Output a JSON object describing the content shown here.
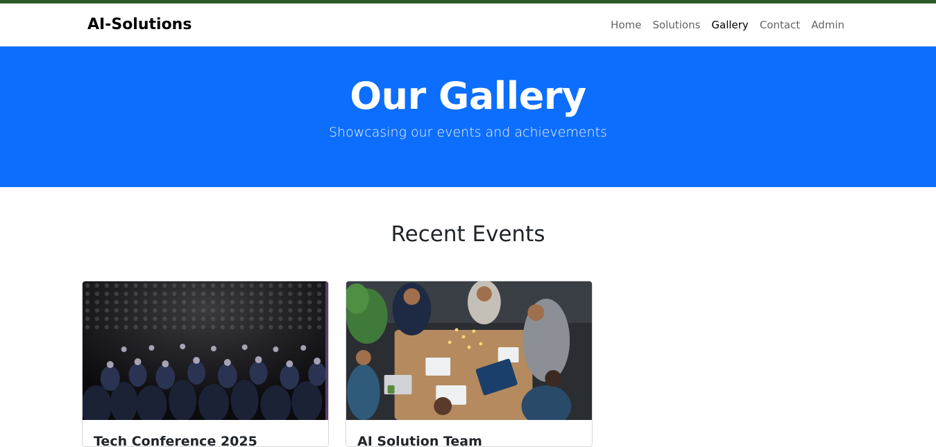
{
  "navbar": {
    "brand": "AI-Solutions",
    "links": [
      "Home",
      "Solutions",
      "Gallery",
      "Contact",
      "Admin"
    ],
    "active": "Gallery"
  },
  "hero": {
    "title": "Our Gallery",
    "subtitle": "Showcasing our events and achievements"
  },
  "section": {
    "title": "Recent Events"
  },
  "cards": [
    {
      "title": "Tech Conference 2025",
      "image": "conference audience in dark auditorium"
    },
    {
      "title": "AI Solution Team",
      "image": "team meeting around table with laptops"
    }
  ],
  "colors": {
    "top_strip": "#2e5a2a",
    "hero_bg": "#0d6efd"
  }
}
